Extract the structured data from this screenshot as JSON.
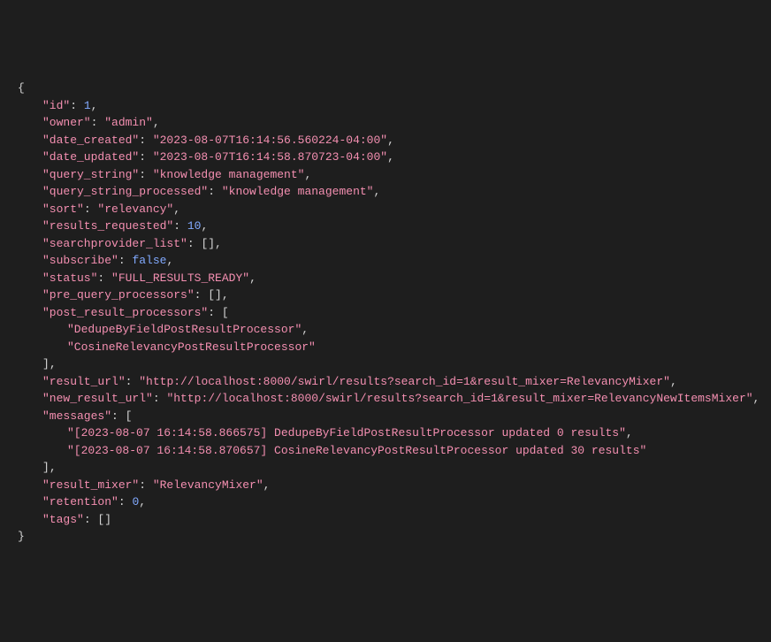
{
  "json": {
    "open": "{",
    "close": "}",
    "keys": {
      "id": "\"id\"",
      "owner": "\"owner\"",
      "date_created": "\"date_created\"",
      "date_updated": "\"date_updated\"",
      "query_string": "\"query_string\"",
      "query_string_processed": "\"query_string_processed\"",
      "sort": "\"sort\"",
      "results_requested": "\"results_requested\"",
      "searchprovider_list": "\"searchprovider_list\"",
      "subscribe": "\"subscribe\"",
      "status": "\"status\"",
      "pre_query_processors": "\"pre_query_processors\"",
      "post_result_processors": "\"post_result_processors\"",
      "result_url": "\"result_url\"",
      "new_result_url": "\"new_result_url\"",
      "messages": "\"messages\"",
      "result_mixer": "\"result_mixer\"",
      "retention": "\"retention\"",
      "tags": "\"tags\""
    },
    "vals": {
      "id": "1",
      "owner": "\"admin\"",
      "date_created": "\"2023-08-07T16:14:56.560224-04:00\"",
      "date_updated": "\"2023-08-07T16:14:58.870723-04:00\"",
      "query_string": "\"knowledge management\"",
      "query_string_processed": "\"knowledge management\"",
      "sort": "\"relevancy\"",
      "results_requested": "10",
      "searchprovider_list": "[]",
      "subscribe": "false",
      "status": "\"FULL_RESULTS_READY\"",
      "pre_query_processors": "[]",
      "post_result_processors_open": "[",
      "post_result_processors_0": "\"DedupeByFieldPostResultProcessor\"",
      "post_result_processors_1": "\"CosineRelevancyPostResultProcessor\"",
      "post_result_processors_close": "]",
      "result_url": "\"http://localhost:8000/swirl/results?search_id=1&result_mixer=RelevancyMixer\"",
      "new_result_url": "\"http://localhost:8000/swirl/results?search_id=1&result_mixer=RelevancyNewItemsMixer\"",
      "messages_open": "[",
      "messages_0": "\"[2023-08-07 16:14:58.866575] DedupeByFieldPostResultProcessor updated 0 results\"",
      "messages_1": "\"[2023-08-07 16:14:58.870657] CosineRelevancyPostResultProcessor updated 30 results\"",
      "messages_close": "]",
      "result_mixer": "\"RelevancyMixer\"",
      "retention": "0",
      "tags": "[]"
    },
    "punct": {
      "colon": ": ",
      "comma": ","
    }
  }
}
